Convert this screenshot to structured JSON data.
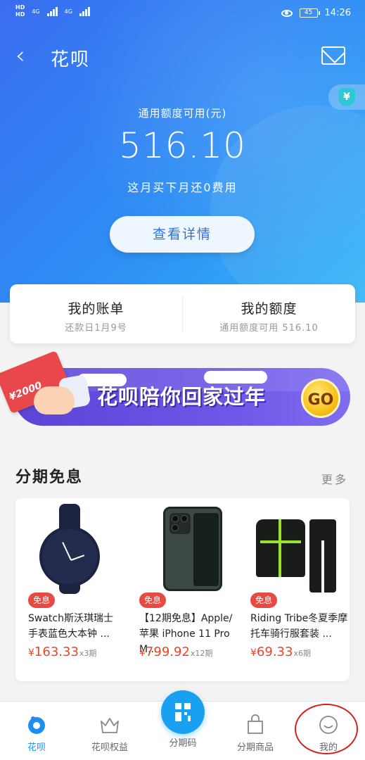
{
  "status_bar": {
    "sim1": "HD",
    "sim2": "HD",
    "network1": "4G",
    "network2": "4G",
    "battery": "45",
    "time": "14:26"
  },
  "nav": {
    "title": "花呗",
    "back_icon": "chevron-left-icon",
    "message_icon": "mail-icon",
    "shield_icon": "yuan-shield-icon",
    "shield_glyph": "¥"
  },
  "credit": {
    "label": "通用额度可用(元)",
    "value": "516.10",
    "subtitle": "这月买下月还0费用",
    "detail_button": "查看详情"
  },
  "summary": {
    "bill_title": "我的账单",
    "bill_sub": "还款日1月9号",
    "quota_title": "我的额度",
    "quota_sub": "通用额度可用 516.10"
  },
  "banner": {
    "amount": "¥2000",
    "text": "花呗陪你回家过年",
    "go": "GO"
  },
  "section": {
    "title": "分期免息",
    "more": "更多"
  },
  "products": [
    {
      "tag": "免息",
      "name_line1": "Swatch斯沃琪瑞士",
      "name_line2": "手表蓝色大本钟 ...",
      "currency": "¥",
      "price": "163.33",
      "term": "x3期"
    },
    {
      "tag": "免息",
      "name_line1": "【12期免息】Apple/",
      "name_line2": "苹果 iPhone 11 Pro M...",
      "currency": "¥",
      "price": "799.92",
      "term": "x12期"
    },
    {
      "tag": "免息",
      "name_line1": "Riding Tribe冬夏季摩",
      "name_line2": "托车骑行服套装 ...",
      "currency": "¥",
      "price": "69.33",
      "term": "x6期"
    }
  ],
  "tabbar": {
    "tabs": [
      {
        "label": "花呗",
        "icon": "huabei-logo-icon"
      },
      {
        "label": "花呗权益",
        "icon": "crown-icon"
      },
      {
        "label": "分期码",
        "icon": "qr-code-icon"
      },
      {
        "label": "分期商品",
        "icon": "shopping-bag-icon"
      },
      {
        "label": "我的",
        "icon": "smile-face-icon"
      }
    ]
  },
  "colors": {
    "accent": "#1e8ef0",
    "price": "#e5482c",
    "tag": "#e54b42",
    "annotation": "#d62020"
  }
}
